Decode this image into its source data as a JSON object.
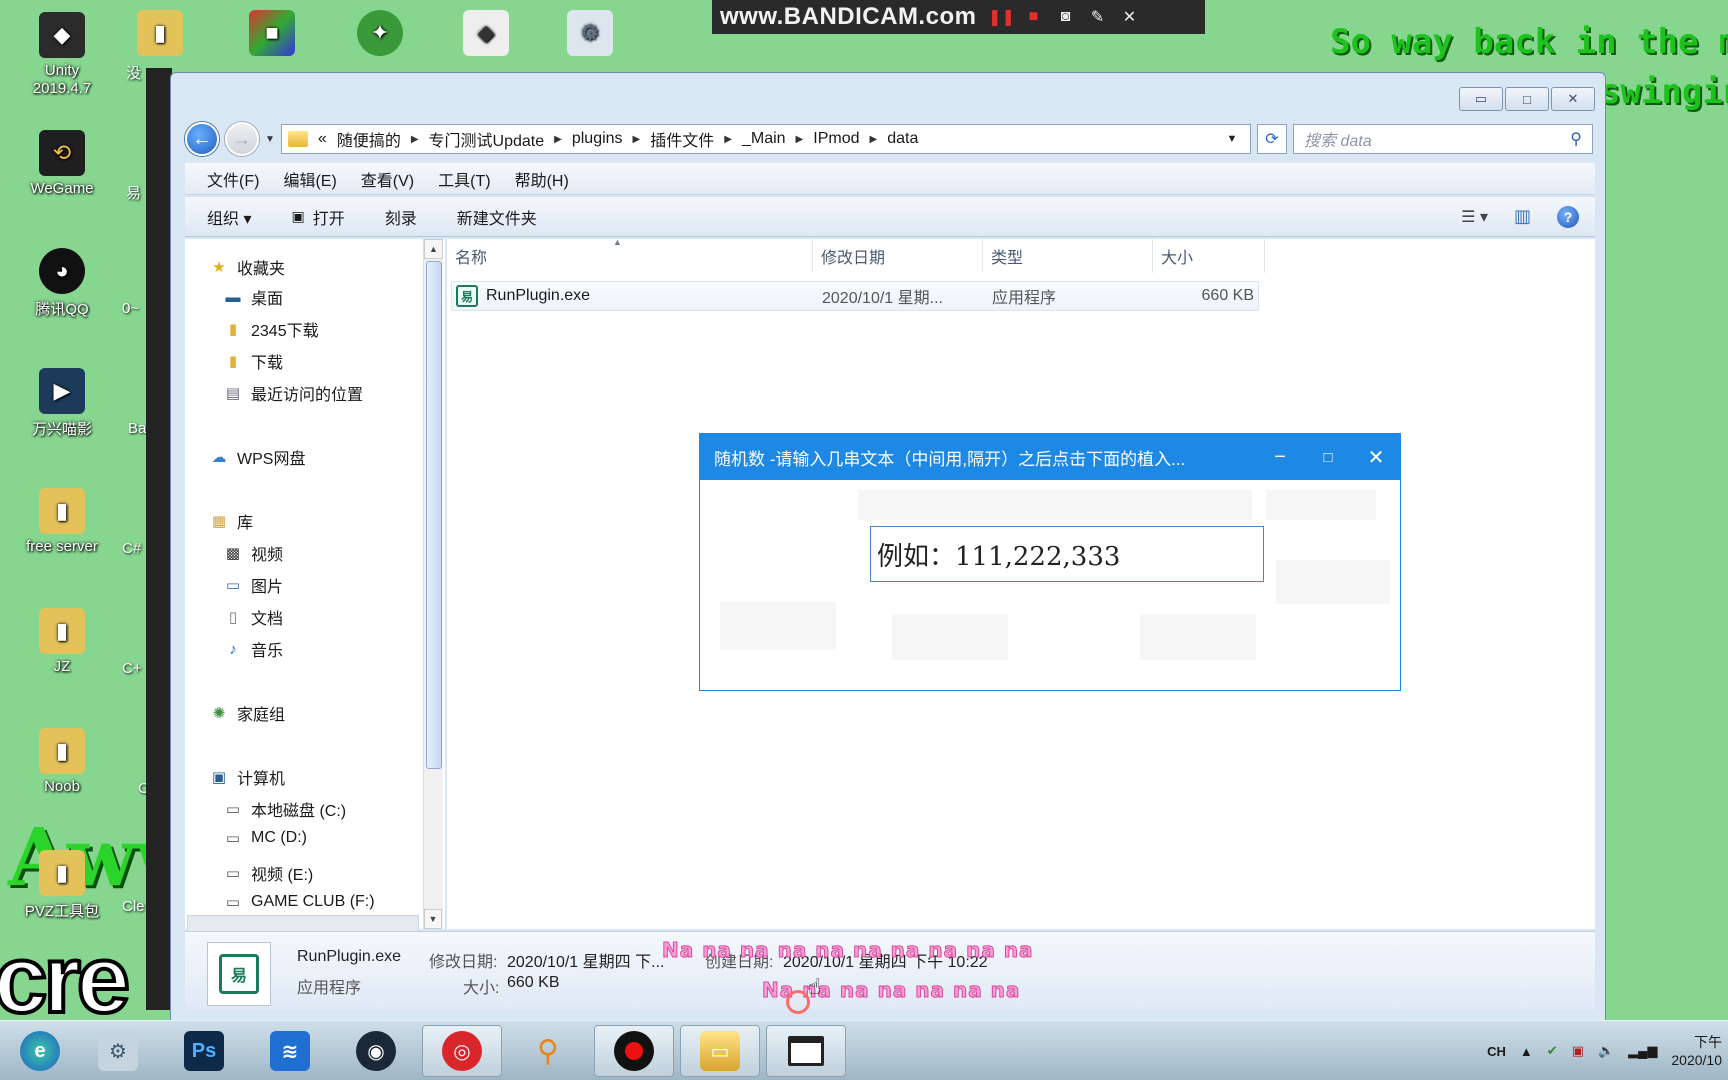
{
  "bandicam": {
    "brand": "www.BANDICAM.com"
  },
  "desktop": {
    "icons": [
      {
        "label": "Unity\n2019.4.7",
        "color": "#222222",
        "glyph": "◆"
      },
      {
        "label": "WeGame",
        "color": "#1f1f1f",
        "glyph": "⟲"
      },
      {
        "label": "腾讯QQ",
        "color": "#111111",
        "glyph": "◕"
      },
      {
        "label": "万兴喵影",
        "color": "#1d3a5a",
        "glyph": "▶"
      },
      {
        "label": "free server",
        "color": "#e4c25a",
        "glyph": "▮"
      },
      {
        "label": "JZ",
        "color": "#e4c25a",
        "glyph": "▮"
      },
      {
        "label": "Noob",
        "color": "#e4c25a",
        "glyph": "▮"
      },
      {
        "label": "PVZ工具包",
        "color": "#e4c25a",
        "glyph": "▮"
      }
    ],
    "partials": [
      "没",
      "易",
      "0~",
      "Ba",
      "C#",
      "C+",
      "C",
      "Cle"
    ],
    "lyrics_green": [
      "So way back in the mine",
      "swinging"
    ],
    "big_left": "Awww",
    "big_cre": "cre"
  },
  "window": {
    "caption": {
      "min": "▭",
      "max": "□",
      "close": "✕"
    },
    "address": {
      "prefix": "«",
      "crumbs": [
        "随便搞的",
        "专门测试Update",
        "plugins",
        "插件文件",
        "_Main",
        "IPmod",
        "data"
      ]
    },
    "search_placeholder": "搜索 data",
    "menu": [
      "文件(F)",
      "编辑(E)",
      "查看(V)",
      "工具(T)",
      "帮助(H)"
    ],
    "toolbar": {
      "organize": "组织 ▾",
      "open": "打开",
      "burn": "刻录",
      "new_folder": "新建文件夹"
    },
    "nav": {
      "favorites": "收藏夹",
      "desktop": "桌面",
      "dl2345": "2345下载",
      "downloads": "下载",
      "recent": "最近访问的位置",
      "wps": "WPS网盘",
      "library": "库",
      "videos": "视频",
      "pictures": "图片",
      "documents": "文档",
      "music": "音乐",
      "homegroup": "家庭组",
      "computer": "计算机",
      "drive_c": "本地磁盘 (C:)",
      "drive_d": "MC (D:)",
      "drive_e": "视频 (E:)",
      "drive_f": "GAME CLUB (F:)"
    },
    "columns": {
      "name": "名称",
      "modified": "修改日期",
      "type": "类型",
      "size": "大小"
    },
    "file": {
      "name": "RunPlugin.exe",
      "modified": "2020/10/1 星期...",
      "type": "应用程序",
      "size": "660 KB"
    },
    "details": {
      "name": "RunPlugin.exe",
      "modified_label": "修改日期:",
      "modified": "2020/10/1 星期四 下...",
      "created_label": "创建日期:",
      "created": "2020/10/1 星期四 下午 10:22",
      "type": "应用程序",
      "size_label": "大小:",
      "size": "660 KB"
    }
  },
  "dialog": {
    "title": "随机数   -请输入几串文本（中间用,隔开）之后点击下面的植入...",
    "input_value": "例如：111,222,333",
    "min": "−",
    "max": "□",
    "close": "✕"
  },
  "lyrics_pink": [
    "Na na na na na na na na na na",
    "Na na na na na na na"
  ],
  "taskbar": {
    "lang": "CH",
    "time": "下午",
    "date": "2020/10"
  }
}
